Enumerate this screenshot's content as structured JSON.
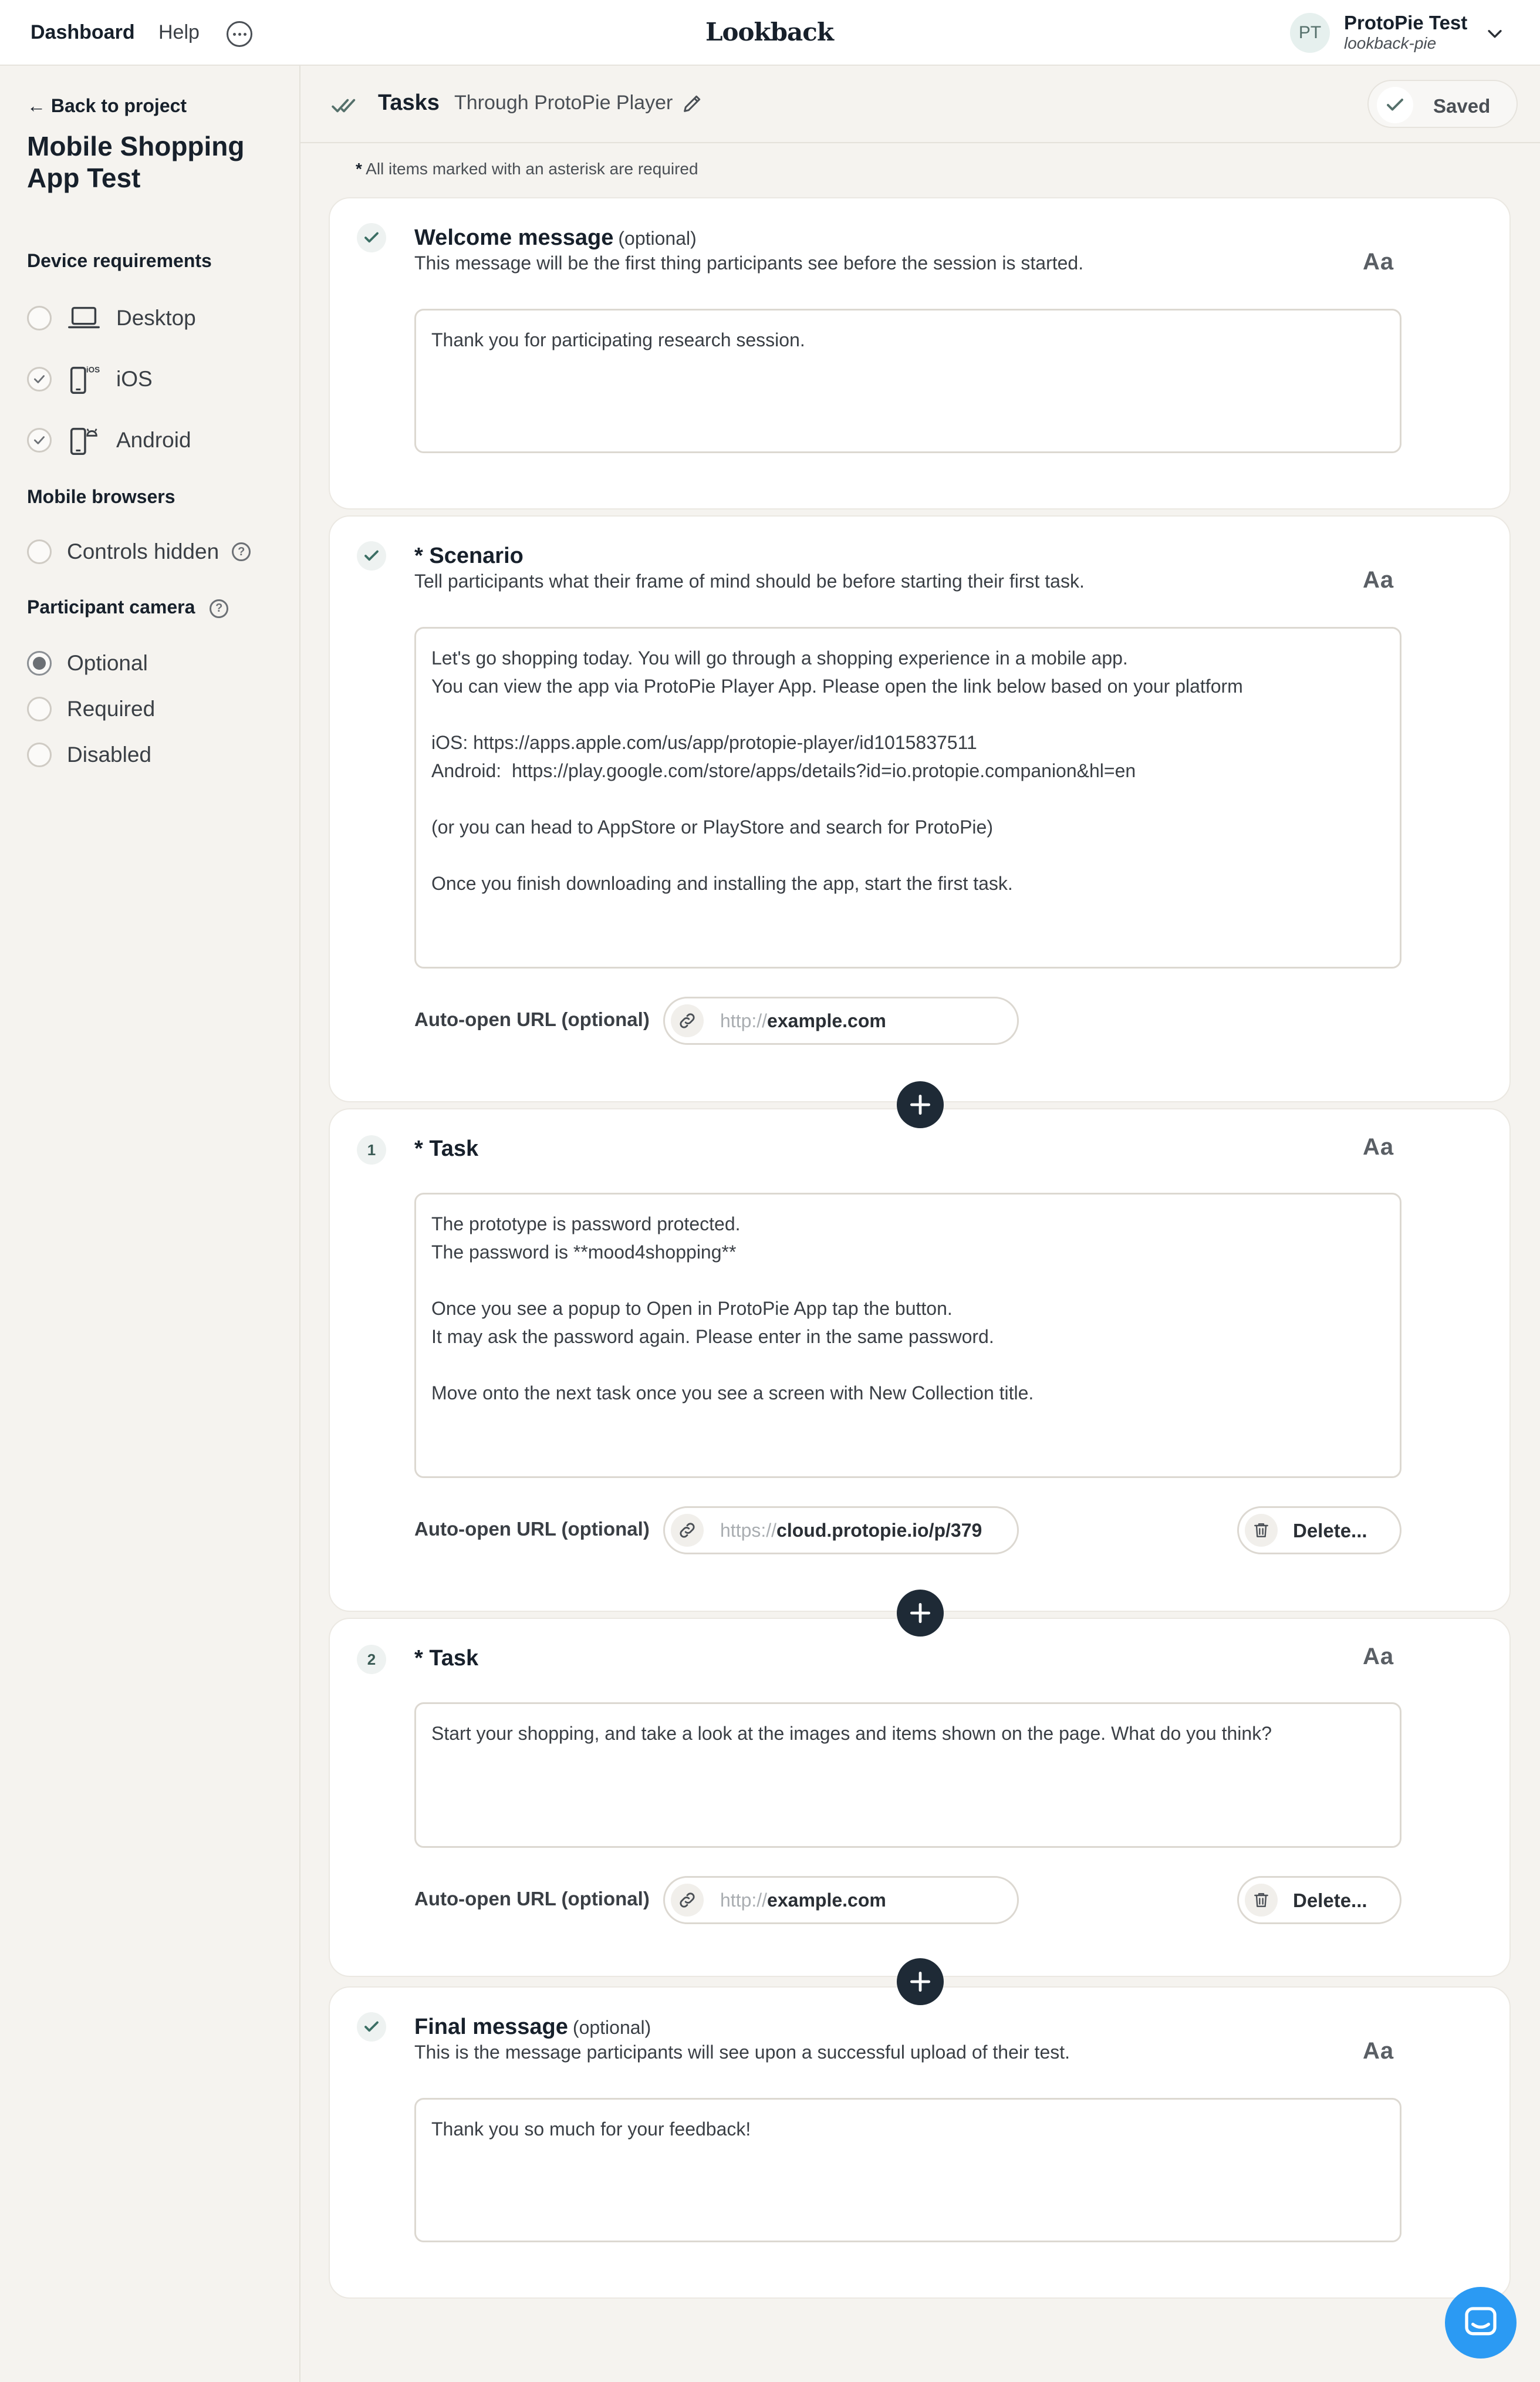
{
  "topbar": {
    "nav": {
      "dashboard": "Dashboard",
      "help": "Help"
    },
    "logo": "Lookback",
    "user": {
      "initials": "PT",
      "name": "ProtoPie Test",
      "handle": "lookback-pie"
    }
  },
  "sidebar": {
    "back_label": "← Back to project",
    "project_title": "Mobile Shopping App Test",
    "device_requirements": {
      "heading": "Device requirements",
      "options": [
        {
          "label": "Desktop",
          "icon": "laptop-icon",
          "checked": false
        },
        {
          "label": "iOS",
          "icon": "ios-phone-icon",
          "checked": true
        },
        {
          "label": "Android",
          "icon": "android-phone-icon",
          "checked": true
        }
      ]
    },
    "mobile_browsers": {
      "heading": "Mobile browsers",
      "options": [
        {
          "label": "Controls hidden",
          "checked": false
        }
      ]
    },
    "participant_camera": {
      "heading": "Participant camera",
      "options": [
        {
          "label": "Optional",
          "selected": true
        },
        {
          "label": "Required",
          "selected": false
        },
        {
          "label": "Disabled",
          "selected": false
        }
      ]
    }
  },
  "header": {
    "title": "Tasks",
    "subtitle": "Through ProtoPie Player",
    "saved_label": "Saved"
  },
  "required_note": {
    "star": "*",
    "text": " All items marked with an asterisk are required"
  },
  "aa_label": "Aa",
  "welcome": {
    "title": "Welcome message",
    "optional": "(optional)",
    "description": "This message will be the first thing participants see before the session is started.",
    "text": "Thank you for participating research session."
  },
  "scenario": {
    "title": "* Scenario",
    "description": "Tell participants what their frame of mind should be before starting their first task.",
    "text": "Let's go shopping today. You will go through a shopping experience in a mobile app.\nYou can view the app via ProtoPie Player App. Please open the link below based on your platform\n\niOS: https://apps.apple.com/us/app/protopie-player/id1015837511\nAndroid:  https://play.google.com/store/apps/details?id=io.protopie.companion&hl=en\n\n(or you can head to AppStore or PlayStore and search for ProtoPie)\n\nOnce you finish downloading and installing the app, start the first task.",
    "url_label": "Auto-open URL (optional)",
    "url_scheme": "http://",
    "url_value": "example.com"
  },
  "tasks": [
    {
      "number": "1",
      "title": "* Task",
      "text": "The prototype is password protected.\nThe password is **mood4shopping**\n\nOnce you see a popup to Open in ProtoPie App tap the button.\nIt may ask the password again. Please enter in the same password.\n\nMove onto the next task once you see a screen with New Collection title.",
      "url_label": "Auto-open URL (optional)",
      "url_scheme": "https://",
      "url_value": "cloud.protopie.io/p/379",
      "delete_label": "Delete..."
    },
    {
      "number": "2",
      "title": "* Task",
      "text": "Start your shopping, and take a look at the images and items shown on the page. What do you think?",
      "url_label": "Auto-open URL (optional)",
      "url_scheme": "http://",
      "url_value": "example.com",
      "delete_label": "Delete..."
    }
  ],
  "final": {
    "title": "Final message",
    "optional": "(optional)",
    "description": "This is the message participants will see upon a successful upload of their test.",
    "text": "Thank you so much for your feedback!"
  },
  "colors": {
    "accent_dark": "#1e2a36",
    "tick_green": "#3b6e64",
    "chat_blue": "#2b9af3"
  }
}
